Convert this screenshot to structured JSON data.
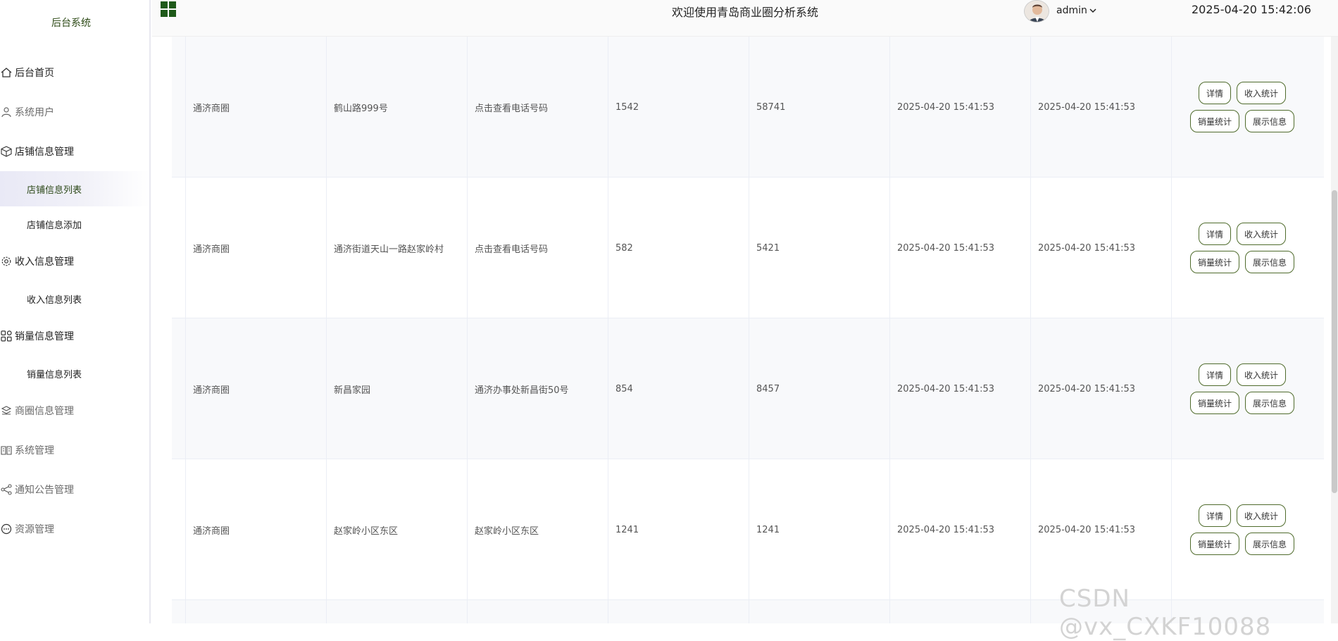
{
  "sidebar": {
    "brand": "后台系统",
    "items": [
      {
        "label": "后台首页"
      },
      {
        "label": "系统用户"
      },
      {
        "label": "店铺信息管理"
      },
      {
        "label": "店铺信息列表"
      },
      {
        "label": "店铺信息添加"
      },
      {
        "label": "收入信息管理"
      },
      {
        "label": "收入信息列表"
      },
      {
        "label": "销量信息管理"
      },
      {
        "label": "销量信息列表"
      },
      {
        "label": "商圈信息管理"
      },
      {
        "label": "系统管理"
      },
      {
        "label": "通知公告管理"
      },
      {
        "label": "资源管理"
      }
    ]
  },
  "header": {
    "welcome": "欢迎使用青岛商业圈分析系统",
    "username": "admin",
    "datetime": "2025-04-20 15:42:06"
  },
  "table": {
    "actions": {
      "detail": "详情",
      "income": "收入统计",
      "sales": "销量统计",
      "display": "展示信息"
    },
    "rows": [
      {
        "circle": "通济商圈",
        "address": "鹤山路999号",
        "phone": "点击查看电话号码",
        "a": "1542",
        "b": "58741",
        "created": "2025-04-20 15:41:53",
        "updated": "2025-04-20 15:41:53"
      },
      {
        "circle": "通济商圈",
        "address": "通济街道天山一路赵家岭村",
        "phone": "点击查看电话号码",
        "a": "582",
        "b": "5421",
        "created": "2025-04-20 15:41:53",
        "updated": "2025-04-20 15:41:53"
      },
      {
        "circle": "通济商圈",
        "address": "新昌家园",
        "phone": "通济办事处新昌街50号",
        "a": "854",
        "b": "8457",
        "created": "2025-04-20 15:41:53",
        "updated": "2025-04-20 15:41:53"
      },
      {
        "circle": "通济商圈",
        "address": "赵家岭小区东区",
        "phone": "赵家岭小区东区",
        "a": "1241",
        "b": "1241",
        "created": "2025-04-20 15:41:53",
        "updated": "2025-04-20 15:41:53"
      }
    ]
  },
  "watermark": "CSDN @vx_CXKF10088"
}
